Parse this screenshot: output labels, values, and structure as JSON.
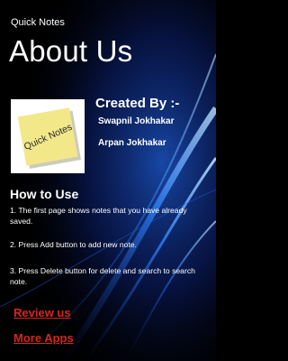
{
  "app": {
    "name": "Quick Notes"
  },
  "page": {
    "title": "About Us"
  },
  "logo": {
    "text": "Quick Notes",
    "icon": "sticky-note-icon",
    "note_color": "#f3e889"
  },
  "credits": {
    "heading": "Created By :-",
    "authors": [
      "Swapnil  Jokhakar",
      "Arpan  Jokhakar"
    ]
  },
  "how_to_use": {
    "heading": "How to Use",
    "steps": [
      "1. The first page shows notes that you have already saved.",
      "2. Press Add button to add new note.",
      "3. Press Delete button for delete and search to search note."
    ]
  },
  "links": {
    "review": "Review us",
    "more_apps": "More Apps"
  },
  "colors": {
    "link": "#d7261d",
    "background": "#000000",
    "accent_streaks": "#2f86ff"
  }
}
